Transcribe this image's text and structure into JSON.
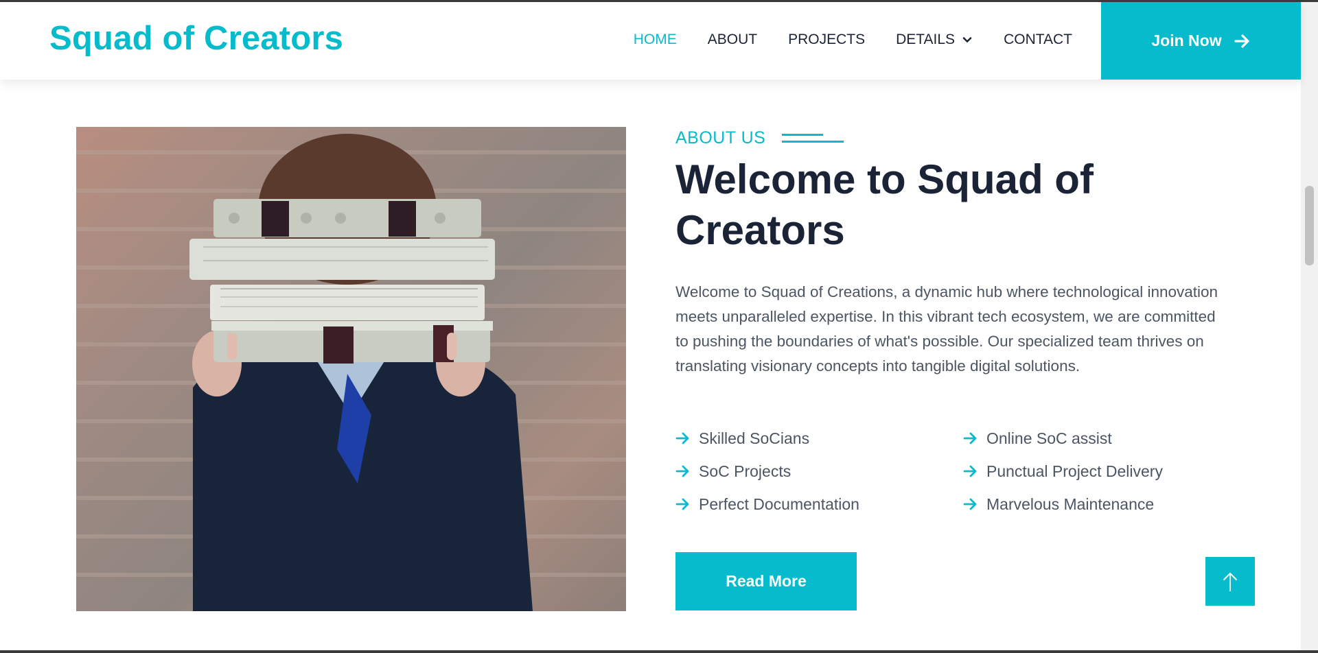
{
  "brand": {
    "name": "Squad of Creators"
  },
  "nav": {
    "items": [
      {
        "label": "HOME",
        "active": true
      },
      {
        "label": "ABOUT"
      },
      {
        "label": "PROJECTS"
      },
      {
        "label": "DETAILS",
        "has_dropdown": true
      },
      {
        "label": "CONTACT"
      }
    ],
    "join_label": "Join Now"
  },
  "about": {
    "kicker": "ABOUT US",
    "title": "Welcome to Squad of Creators",
    "description": "Welcome to Squad of Creations, a dynamic hub where technological innovation meets unparalleled expertise. In this vibrant tech ecosystem, we are committed to pushing the boundaries of what's possible. Our specialized team thrives on translating visionary concepts into tangible digital solutions.",
    "features": [
      "Skilled SoCians",
      "Online SoC assist",
      "SoC Projects",
      "Punctual Project Delivery",
      "Perfect Documentation",
      "Marvelous Maintenance"
    ],
    "read_more_label": "Read More"
  },
  "colors": {
    "accent": "#06bbcc",
    "heading": "#1b2337",
    "body_text": "#4c5563"
  },
  "icons": {
    "feature": "arrow-right-icon",
    "join": "arrow-right-icon",
    "back_to_top": "arrow-up-icon",
    "dropdown": "chevron-down-icon"
  }
}
